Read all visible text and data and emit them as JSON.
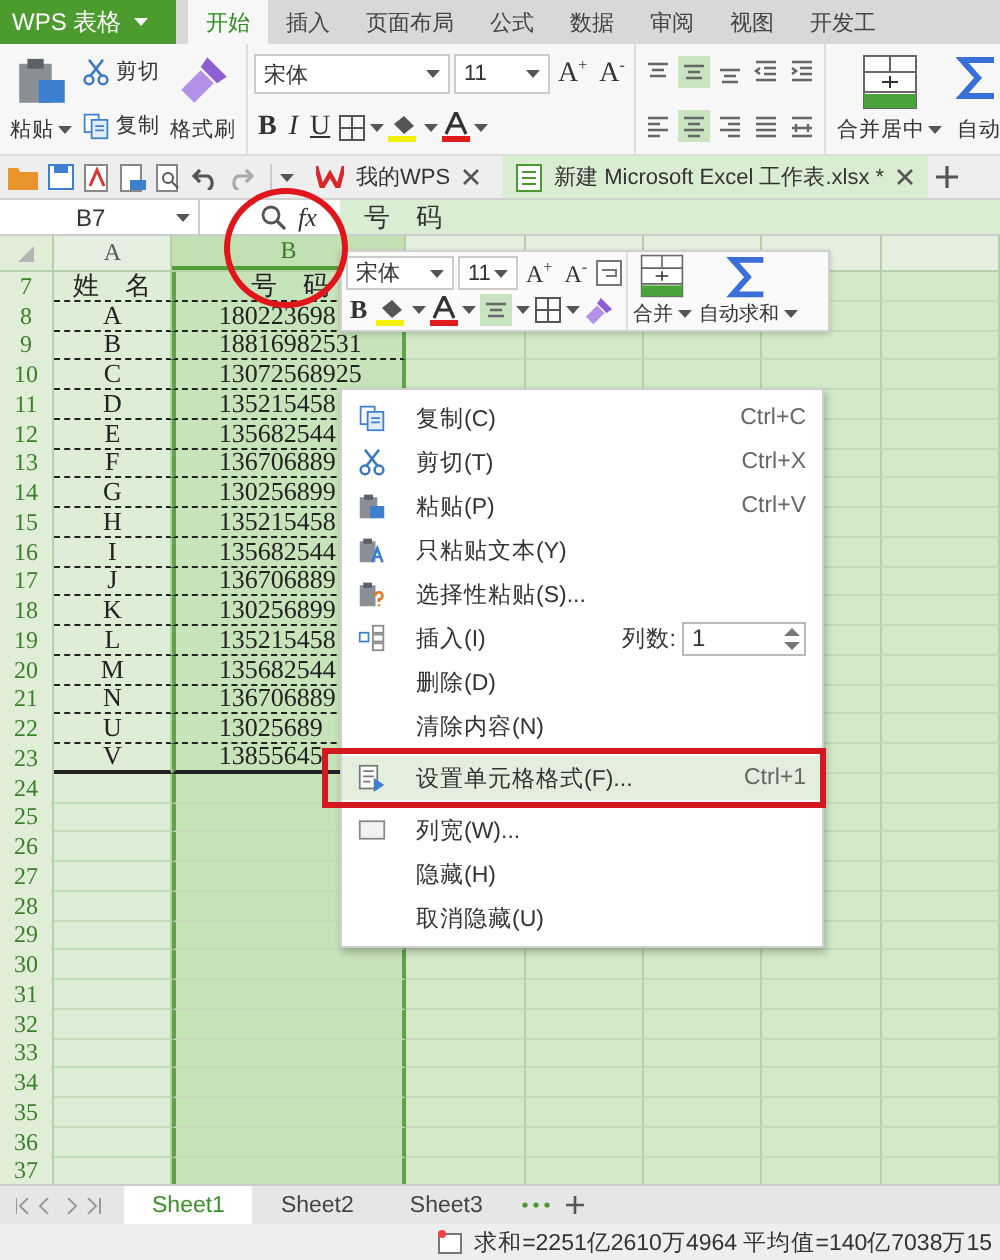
{
  "app_button": {
    "label": "WPS 表格"
  },
  "tabs": [
    {
      "label": "开始",
      "selected": true
    },
    {
      "label": "插入",
      "selected": false
    },
    {
      "label": "页面布局",
      "selected": false
    },
    {
      "label": "公式",
      "selected": false
    },
    {
      "label": "数据",
      "selected": false
    },
    {
      "label": "审阅",
      "selected": false
    },
    {
      "label": "视图",
      "selected": false
    },
    {
      "label": "开发工",
      "selected": false
    }
  ],
  "ribbon": {
    "clipboard": [
      {
        "label": "粘贴",
        "kind": "paste"
      },
      {
        "label": "剪切",
        "kind": "cut"
      },
      {
        "label": "复制",
        "kind": "copy"
      },
      {
        "label": "格式刷",
        "kind": "brush"
      }
    ],
    "font_name": "宋体",
    "font_size": "11",
    "grow": "A$^{+}$",
    "shrink": "A$^{-}$",
    "bold": "B",
    "italic": "I",
    "underline": "U",
    "align_top": [
      {
        "kind": "top",
        "selected": false
      },
      {
        "kind": "middle",
        "selected": true
      },
      {
        "kind": "bottom",
        "selected": false
      },
      {
        "kind": "outdent",
        "selected": false
      },
      {
        "kind": "indent",
        "selected": false
      }
    ],
    "align_bottom": [
      {
        "kind": "left",
        "selected": false
      },
      {
        "kind": "center",
        "selected": true
      },
      {
        "kind": "right",
        "selected": false
      },
      {
        "kind": "justify",
        "selected": false
      },
      {
        "kind": "distributed",
        "selected": false
      }
    ],
    "merge": "合并居中",
    "autosum": "自动"
  },
  "doc_tabs": [
    {
      "label": "我的WPS",
      "selected": false
    },
    {
      "label": "新建 Microsoft Excel 工作表.xlsx *",
      "selected": true
    }
  ],
  "formula_bar": {
    "cell": "B7",
    "function_label": "fx",
    "content": "号　码"
  },
  "columns": [
    {
      "label": "A",
      "selected": false
    },
    {
      "label": "B",
      "selected": true
    }
  ],
  "rows": [
    {
      "number": "7",
      "name": "姓　名",
      "phone": "号　码"
    },
    {
      "number": "8",
      "name": "A",
      "phone": "180223698"
    },
    {
      "number": "9",
      "name": "B",
      "phone": "18816982531"
    },
    {
      "number": "10",
      "name": "C",
      "phone": "13072568925"
    },
    {
      "number": "11",
      "name": "D",
      "phone": "135215458"
    },
    {
      "number": "12",
      "name": "E",
      "phone": "135682544"
    },
    {
      "number": "13",
      "name": "F",
      "phone": "136706889"
    },
    {
      "number": "14",
      "name": "G",
      "phone": "130256899"
    },
    {
      "number": "15",
      "name": "H",
      "phone": "135215458"
    },
    {
      "number": "16",
      "name": "I",
      "phone": "135682544"
    },
    {
      "number": "17",
      "name": "J",
      "phone": "136706889"
    },
    {
      "number": "18",
      "name": "K",
      "phone": "130256899"
    },
    {
      "number": "19",
      "name": "L",
      "phone": "135215458"
    },
    {
      "number": "20",
      "name": "M",
      "phone": "135682544"
    },
    {
      "number": "21",
      "name": "N",
      "phone": "136706889"
    },
    {
      "number": "22",
      "name": "U",
      "phone": "13025689"
    },
    {
      "number": "23",
      "name": "V",
      "phone": "13855645"
    },
    {
      "number": "24"
    },
    {
      "number": "25"
    },
    {
      "number": "26"
    },
    {
      "number": "27"
    },
    {
      "number": "28"
    },
    {
      "number": "29"
    },
    {
      "number": "30"
    },
    {
      "number": "31"
    },
    {
      "number": "32"
    },
    {
      "number": "33"
    },
    {
      "number": "34"
    },
    {
      "number": "35"
    },
    {
      "number": "36"
    },
    {
      "number": "37"
    }
  ],
  "mini_toolbar": {
    "font_name": "宋体",
    "font_size": "11",
    "grow": "A$^{+}$",
    "shrink": "A$^{-}$",
    "bold": "B",
    "merge": "合并",
    "autosum": "自动求和"
  },
  "menu": {
    "items": [
      {
        "kind": "copy",
        "label": "复制(C)",
        "shortcut": "Ctrl+C",
        "selected": false,
        "boxed": false
      },
      {
        "kind": "cut",
        "label": "剪切(T)",
        "shortcut": "Ctrl+X",
        "selected": false,
        "boxed": false
      },
      {
        "kind": "paste",
        "label": "粘贴(P)",
        "shortcut": "Ctrl+V",
        "selected": false,
        "boxed": false
      },
      {
        "kind": "paste-text",
        "label": "只粘贴文本(Y)",
        "selected": false,
        "boxed": false
      },
      {
        "kind": "paste-special",
        "label": "选择性粘贴(S)...",
        "selected": false,
        "boxed": false
      },
      {
        "kind": "insert",
        "label": "插入(I)",
        "count_label": "列数:",
        "count": "1",
        "selected": false,
        "boxed": false
      },
      {
        "kind": "plain",
        "label": "删除(D)",
        "selected": false,
        "boxed": false
      },
      {
        "kind": "plain",
        "label": "清除内容(N)",
        "selected": false,
        "boxed": false
      },
      {
        "kind": "format",
        "label": "设置单元格格式(F)...",
        "shortcut": "Ctrl+1",
        "selected": true,
        "boxed": true
      },
      {
        "kind": "width",
        "label": "列宽(W)...",
        "selected": false,
        "boxed": false
      },
      {
        "kind": "plain",
        "label": "隐藏(H)",
        "selected": false,
        "boxed": false
      },
      {
        "kind": "plain",
        "label": "取消隐藏(U)",
        "selected": false,
        "boxed": false
      }
    ]
  },
  "sheets": [
    {
      "label": "Sheet1",
      "selected": true
    },
    {
      "label": "Sheet2",
      "selected": false
    },
    {
      "label": "Sheet3",
      "selected": false
    }
  ],
  "status": {
    "text": "求和=2251亿2610万4964  平均值=140亿7038万15"
  },
  "annotations": [
    {
      "kind": "circle"
    }
  ]
}
